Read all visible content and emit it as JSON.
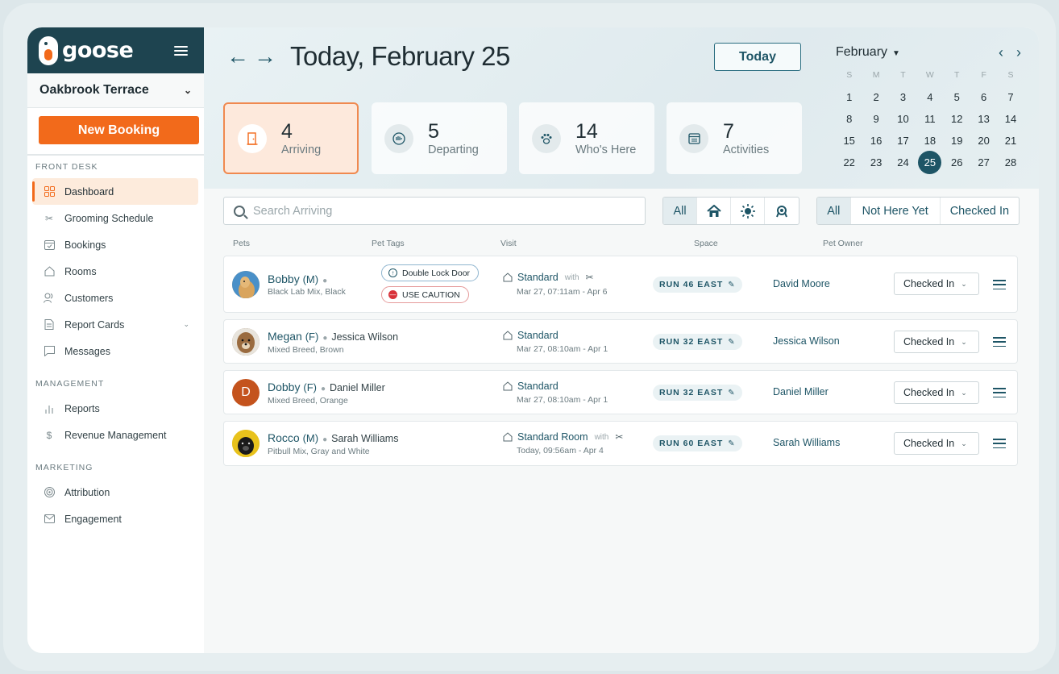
{
  "brand": {
    "name": "goose"
  },
  "location": {
    "name": "Oakbrook Terrace"
  },
  "sidebar": {
    "new_booking_label": "New Booking",
    "sections": [
      {
        "label": "FRONT DESK",
        "items": [
          {
            "label": "Dashboard",
            "icon": "grid-icon"
          },
          {
            "label": "Grooming Schedule",
            "icon": "scissors-icon"
          },
          {
            "label": "Bookings",
            "icon": "calendar-check-icon"
          },
          {
            "label": "Rooms",
            "icon": "home-icon"
          },
          {
            "label": "Customers",
            "icon": "users-icon"
          },
          {
            "label": "Report Cards",
            "icon": "document-icon"
          },
          {
            "label": "Messages",
            "icon": "chat-icon"
          }
        ]
      },
      {
        "label": "MANAGEMENT",
        "items": [
          {
            "label": "Reports",
            "icon": "bar-chart-icon"
          },
          {
            "label": "Revenue Management",
            "icon": "dollar-icon"
          }
        ]
      },
      {
        "label": "MARKETING",
        "items": [
          {
            "label": "Attribution",
            "icon": "target-icon"
          },
          {
            "label": "Engagement",
            "icon": "mail-icon"
          }
        ]
      }
    ]
  },
  "header": {
    "title": "Today, February 25",
    "today_label": "Today"
  },
  "stats": [
    {
      "value": "4",
      "label": "Arriving",
      "icon": "door-icon"
    },
    {
      "value": "5",
      "label": "Departing",
      "icon": "wave-icon"
    },
    {
      "value": "14",
      "label": "Who's Here",
      "icon": "paw-icon"
    },
    {
      "value": "7",
      "label": "Activities",
      "icon": "calendar-icon"
    }
  ],
  "calendar": {
    "month": "February",
    "weekdays": [
      "S",
      "M",
      "T",
      "W",
      "T",
      "F",
      "S"
    ],
    "days": [
      "1",
      "2",
      "3",
      "4",
      "5",
      "6",
      "7",
      "8",
      "9",
      "10",
      "11",
      "12",
      "13",
      "14",
      "15",
      "16",
      "17",
      "18",
      "19",
      "20",
      "21",
      "22",
      "23",
      "24",
      "25",
      "26",
      "27",
      "28"
    ],
    "selected": "25"
  },
  "search": {
    "placeholder": "Search Arriving"
  },
  "filters": {
    "type_all": "All",
    "status_all": "All",
    "status_not_here": "Not Here Yet",
    "status_checked_in": "Checked In"
  },
  "columns": {
    "pets": "Pets",
    "tags": "Pet Tags",
    "visit": "Visit",
    "space": "Space",
    "owner": "Pet Owner"
  },
  "rows": [
    {
      "name": "Bobby",
      "sex": "(M)",
      "owner_inline": "",
      "breed": "Black Lab Mix, Black",
      "avatar": "",
      "avatar_color": "#c9a060",
      "tags": [
        "Double Lock Door",
        "USE CAUTION"
      ],
      "visit": "Standard",
      "with": "with",
      "dates": "Mar 27, 07:11am - Apr 6",
      "space": "RUN 46 EAST",
      "owner": "David Moore",
      "status": "Checked In"
    },
    {
      "name": "Megan",
      "sex": "(F)",
      "owner_inline": "Jessica Wilson",
      "breed": "Mixed Breed, Brown",
      "avatar": "",
      "avatar_color": "#8a6a4a",
      "tags": [],
      "visit": "Standard",
      "with": "",
      "dates": "Mar 27, 08:10am - Apr 1",
      "space": "RUN 32 EAST",
      "owner": "Jessica Wilson",
      "status": "Checked In"
    },
    {
      "name": "Dobby",
      "sex": "(F)",
      "owner_inline": "Daniel Miller",
      "breed": "Mixed Breed, Orange",
      "avatar": "D",
      "avatar_color": "#c4531d",
      "tags": [],
      "visit": "Standard",
      "with": "",
      "dates": "Mar 27, 08:10am - Apr 1",
      "space": "RUN 32 EAST",
      "owner": "Daniel Miller",
      "status": "Checked In"
    },
    {
      "name": "Rocco",
      "sex": "(M)",
      "owner_inline": "Sarah Williams",
      "breed": "Pitbull Mix, Gray and White",
      "avatar": "",
      "avatar_color": "#e8c21c",
      "tags": [],
      "visit": "Standard Room",
      "with": "with",
      "dates": "Today, 09:56am - Apr 4",
      "space": "RUN 60 EAST",
      "owner": "Sarah Williams",
      "status": "Checked In"
    }
  ]
}
